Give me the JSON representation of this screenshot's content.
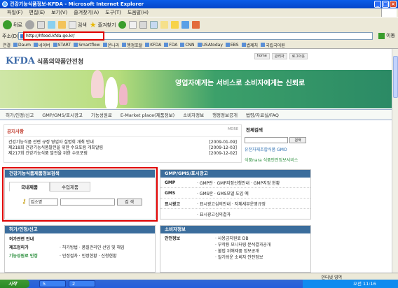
{
  "window": {
    "title": "건강기능식품정보-KFDA - Microsoft Internet Explorer",
    "controls": [
      "_",
      "□",
      "×"
    ]
  },
  "menu": [
    "파일(F)",
    "편집(E)",
    "보기(V)",
    "즐겨찾기(A)",
    "도구(T)",
    "도움말(H)"
  ],
  "toolbar": {
    "back": "뒤로",
    "search": "검색",
    "favorites": "즐겨찾기"
  },
  "address": {
    "label": "주소(D)",
    "url": "http://hfood.kfda.go.kr/",
    "go": "이동"
  },
  "links": {
    "label": "연결",
    "items": [
      "Daum",
      "네이버",
      "START",
      "Smartflow",
      "온나라",
      "행정포탈",
      "KFDA",
      "FDA",
      "CNN",
      "USAtoday",
      "EBS",
      "법제처",
      "국립국어원"
    ]
  },
  "page": {
    "top_links": [
      "home",
      "관리자",
      "로그아웃"
    ],
    "logo_kfda": "KFDA",
    "logo_kr": "식품의약품안전청",
    "slogan": "영업자에게는 서비스로 소비자에게는 신뢰로",
    "nav": [
      "허가/인정/신고",
      "GMP/GMS/표시광고",
      "기능성원료",
      "E-Market place(제품정보)",
      "소비자정보",
      "행정정보공개",
      "법령/자료실/FAQ"
    ],
    "notice": {
      "title": "공지사항",
      "more": "MORE",
      "items": [
        {
          "text": "건강기능식품 관련 규정 영업자 설명회 개최 안내",
          "date": "[2009-01-09]"
        },
        {
          "text": "제218회 건강기능식품발전을 위한 수요포럼 개최알림",
          "date": "[2009-12-03]"
        },
        {
          "text": "제217회 건강기능식품 발전을 위한 수요포럼",
          "date": "[2009-12-02]"
        }
      ]
    },
    "full_search": {
      "title": "전체검색",
      "button": "검색",
      "gmo": "유전자재조합식품 GMO",
      "foodnara": "식품nara 식품안전정보서비스"
    },
    "food_search": {
      "title": "건강기능식품제품정보검색",
      "tabs": [
        "국내제품",
        "수입제품"
      ],
      "select": "업소명",
      "button": "검 색"
    },
    "gmp": {
      "title": "GMP/GMS/표시광고",
      "rows": [
        {
          "k": "GMP",
          "v": "· GMP란 · GMP지정신청안내 · GMP지정 현황"
        },
        {
          "k": "GMS",
          "v": "· GMS란 · GMS모델 도입 예"
        },
        {
          "k": "표시광고",
          "v": "· 표시광고심의안내 · 자체세부운영규정"
        },
        {
          "k": "",
          "v": "· 표시광고심의결과"
        }
      ]
    },
    "permit": {
      "title": "허가/인정/신고",
      "rows": [
        {
          "k": "허가관련 안내",
          "v": ""
        },
        {
          "k": "제조업허가",
          "v": "· 허가방법 · 품질관리인 선임 및 해임"
        },
        {
          "k": "기능성원료 인정",
          "v": "· 인정절차 · 인정현황 · 신청현황"
        }
      ]
    },
    "consumer": {
      "title": "소비자정보",
      "rows": [
        {
          "k": "안전정보",
          "v": "· 사용금지원료 DB"
        },
        {
          "k": "",
          "v": "· 부작용 모니터링 분석결과공개"
        },
        {
          "k": "",
          "v": "· 불법 위해제품 정보공개"
        },
        {
          "k": "",
          "v": "· 알기쉬운 소비자 안전정보"
        }
      ]
    }
  },
  "status": {
    "zone": "인터넷 영역"
  },
  "taskbar": {
    "start": "시작",
    "tasks": [
      "5",
      "2"
    ],
    "clock": "오전 11:16"
  }
}
